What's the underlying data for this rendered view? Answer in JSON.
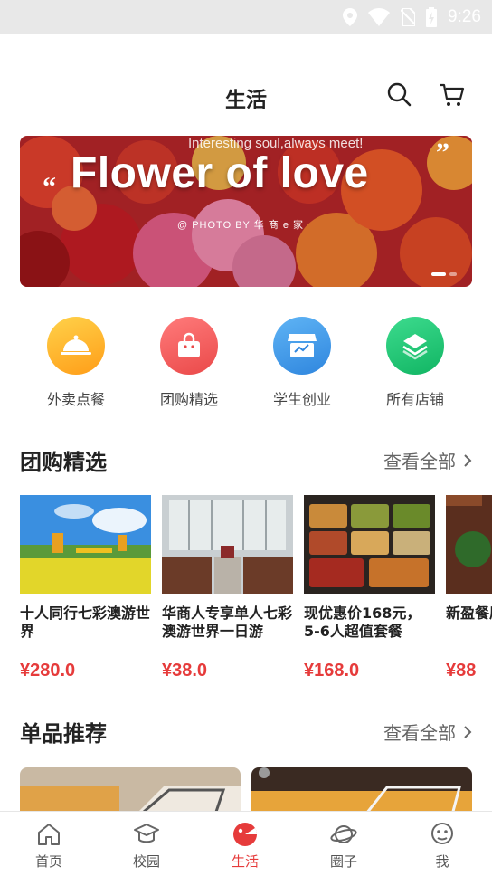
{
  "status_bar": {
    "time": "9:26"
  },
  "header": {
    "title": "生活"
  },
  "banner": {
    "tagline": "Interesting soul,always meet!",
    "title": "Flower of love",
    "credit": "@ PHOTO BY 华 商 e 家"
  },
  "quick_entries": [
    {
      "label": "外卖点餐",
      "icon": "food-cloche-icon",
      "color": "#ffb020"
    },
    {
      "label": "团购精选",
      "icon": "shopping-bag-icon",
      "color": "#f25d5d"
    },
    {
      "label": "学生创业",
      "icon": "storefront-icon",
      "color": "#3d9be9"
    },
    {
      "label": "所有店铺",
      "icon": "layers-icon",
      "color": "#1fc77a"
    }
  ],
  "group_buy": {
    "title": "团购精选",
    "more": "查看全部",
    "items": [
      {
        "name": "十人同行七彩澳游世界",
        "price": "¥280.0"
      },
      {
        "name": "华商人专享单人七彩澳游世界一日游",
        "price": "¥38.0"
      },
      {
        "name": "现优惠价168元，5-6人超值套餐",
        "price": "¥168.0"
      },
      {
        "name": "新盈餐原",
        "price": "¥88"
      }
    ]
  },
  "single": {
    "title": "单品推荐",
    "more": "查看全部"
  },
  "bottom_nav": [
    {
      "label": "首页",
      "icon": "home-icon"
    },
    {
      "label": "校园",
      "icon": "campus-icon"
    },
    {
      "label": "生活",
      "icon": "life-icon",
      "active": true
    },
    {
      "label": "圈子",
      "icon": "planet-icon"
    },
    {
      "label": "我",
      "icon": "profile-icon"
    }
  ],
  "colors": {
    "accent": "#e63b3b"
  }
}
